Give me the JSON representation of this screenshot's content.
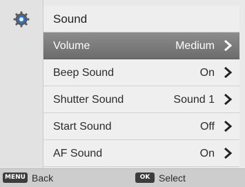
{
  "header": {
    "title": "Sound",
    "icon": "settings-gear-icon"
  },
  "menu": {
    "items": [
      {
        "label": "Volume",
        "value": "Medium",
        "selected": true
      },
      {
        "label": "Beep Sound",
        "value": "On",
        "selected": false
      },
      {
        "label": "Shutter Sound",
        "value": "Sound 1",
        "selected": false
      },
      {
        "label": "Start Sound",
        "value": "Off",
        "selected": false
      },
      {
        "label": "AF Sound",
        "value": "On",
        "selected": false
      }
    ]
  },
  "footer": {
    "menu_key": "MENU",
    "back_label": "Back",
    "ok_key": "OK",
    "select_label": "Select"
  },
  "colors": {
    "background": "#e9e9e9",
    "selected_row": "#7a7a7a",
    "icon_blue": "#2f6fc8"
  }
}
